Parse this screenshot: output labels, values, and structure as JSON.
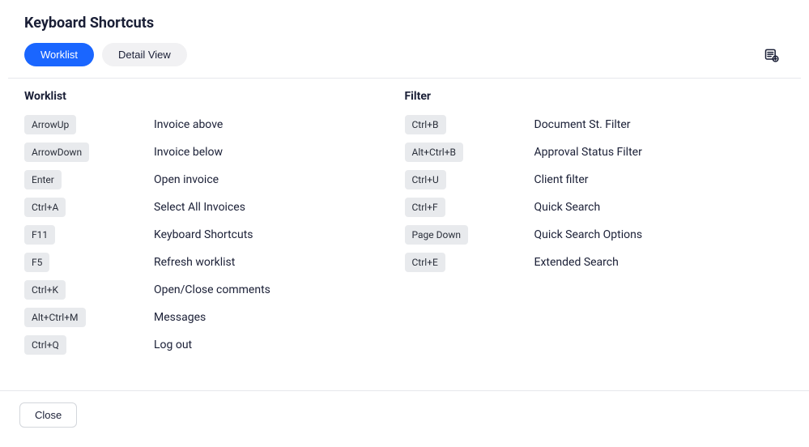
{
  "title": "Keyboard Shortcuts",
  "tabs": {
    "worklist": "Worklist",
    "detail_view": "Detail View"
  },
  "sections": {
    "worklist": {
      "heading": "Worklist",
      "rows": [
        {
          "key": "ArrowUp",
          "desc": "Invoice above"
        },
        {
          "key": "ArrowDown",
          "desc": "Invoice below"
        },
        {
          "key": "Enter",
          "desc": "Open invoice"
        },
        {
          "key": "Ctrl+A",
          "desc": "Select All Invoices"
        },
        {
          "key": "F11",
          "desc": "Keyboard Shortcuts"
        },
        {
          "key": "F5",
          "desc": "Refresh worklist"
        },
        {
          "key": "Ctrl+K",
          "desc": "Open/Close comments"
        },
        {
          "key": "Alt+Ctrl+M",
          "desc": "Messages"
        },
        {
          "key": "Ctrl+Q",
          "desc": "Log out"
        }
      ]
    },
    "filter": {
      "heading": "Filter",
      "rows": [
        {
          "key": "Ctrl+B",
          "desc": "Document St. Filter"
        },
        {
          "key": "Alt+Ctrl+B",
          "desc": "Approval Status Filter"
        },
        {
          "key": "Ctrl+U",
          "desc": "Client filter"
        },
        {
          "key": "Ctrl+F",
          "desc": "Quick Search"
        },
        {
          "key": "Page Down",
          "desc": "Quick Search Options"
        },
        {
          "key": "Ctrl+E",
          "desc": "Extended Search"
        }
      ]
    }
  },
  "footer": {
    "close_label": "Close"
  }
}
